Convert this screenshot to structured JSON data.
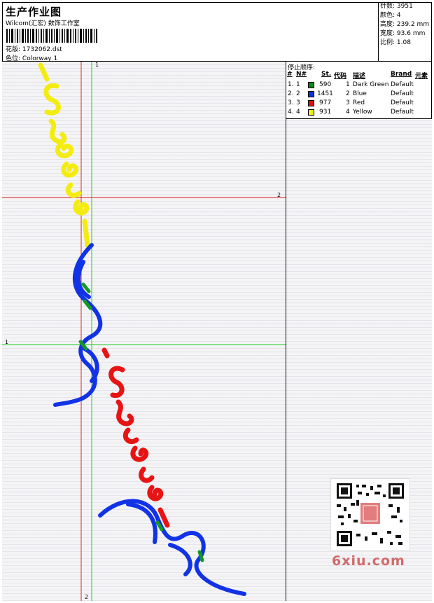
{
  "header": {
    "title": "生产作业图",
    "subtitle": "Wilcom(汇宏) 数饰工作室",
    "design_label": "花版:",
    "design_value": "1732062.dst",
    "colorway_label": "色位:",
    "colorway_value": "Colorway 1"
  },
  "stats": [
    {
      "label": "针数:",
      "value": "3951"
    },
    {
      "label": "颜色:",
      "value": "4"
    },
    {
      "label": "高度:",
      "value": "239.2 mm"
    },
    {
      "label": "宽度:",
      "value": "93.6 mm"
    },
    {
      "label": "比例:",
      "value": "1.08"
    }
  ],
  "stop_sequence": {
    "label": "停止顺序:",
    "columns": [
      "#",
      "N#",
      "St.",
      "代码",
      "描述",
      "Brand",
      "元素"
    ],
    "rows": [
      {
        "idx": "1.",
        "n": "1",
        "color": "#0a8a1e",
        "st": "590",
        "code": "1",
        "desc": "Dark Green",
        "brand": "Default"
      },
      {
        "idx": "2.",
        "n": "2",
        "color": "#1030e0",
        "st": "1451",
        "code": "2",
        "desc": "Blue",
        "brand": "Default"
      },
      {
        "idx": "3.",
        "n": "3",
        "color": "#e01010",
        "st": "977",
        "code": "3",
        "desc": "Red",
        "brand": "Default"
      },
      {
        "idx": "4.",
        "n": "4",
        "color": "#f0f010",
        "st": "931",
        "code": "4",
        "desc": "Yellow",
        "brand": "Default"
      }
    ]
  },
  "guides": {
    "red_vertical_top": "1",
    "green_vertical_top": "1",
    "red_horizontal_right": "2",
    "green_horizontal_left": "1",
    "red_vertical_bottom": "2"
  },
  "watermark": "6xiu.com",
  "colors": {
    "yellow": "#f4ec10",
    "blue": "#1232e6",
    "red": "#e81414",
    "green": "#129a24",
    "guide_red": "#e02020",
    "guide_green": "#20d020"
  }
}
